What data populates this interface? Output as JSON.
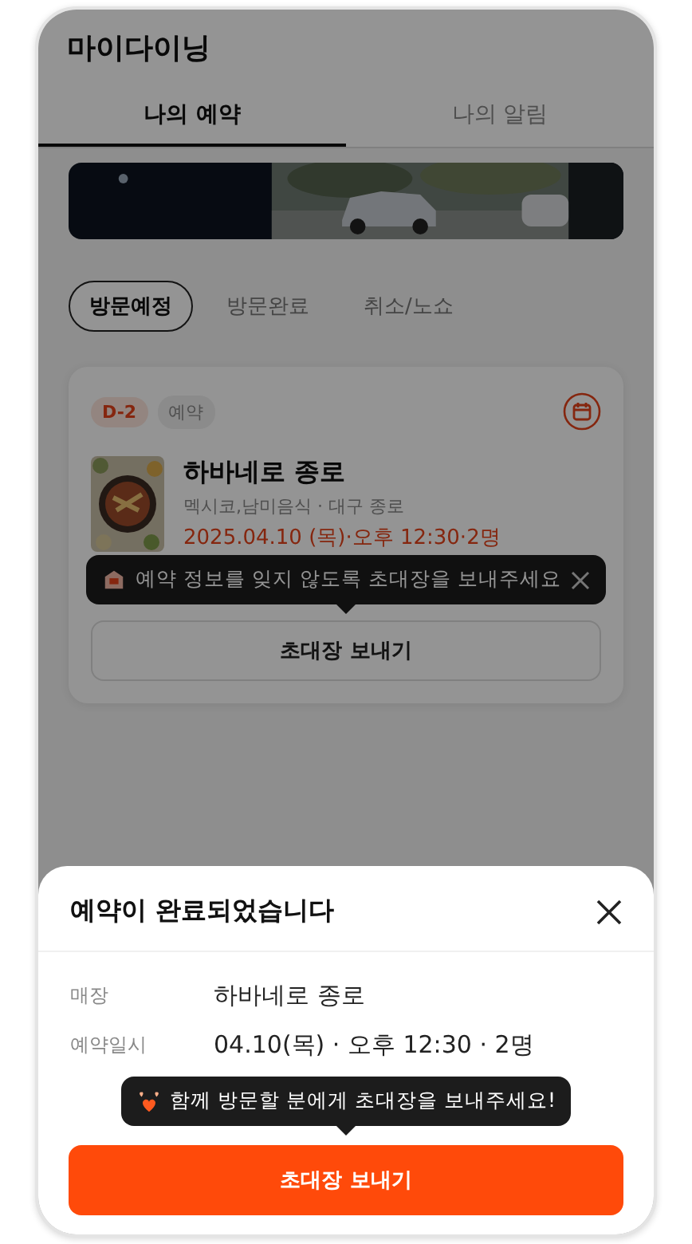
{
  "header": {
    "title": "마이다이닝"
  },
  "tabs": [
    {
      "label": "나의 예약",
      "selected": true
    },
    {
      "label": "나의 알림",
      "selected": false
    }
  ],
  "filters": [
    {
      "label": "방문예정",
      "selected": true
    },
    {
      "label": "방문완료",
      "selected": false
    },
    {
      "label": "취소/노쇼",
      "selected": false
    }
  ],
  "reservation_card": {
    "dday": "D-2",
    "status": "예약",
    "restaurant": "하바네로 종로",
    "category": "멕시코,남미음식 · 대구 종로",
    "datetime": "2025.04.10 (목)·오후 12:30·2명",
    "tooltip": "예약 정보를 잊지 않도록 초대장을 보내주세요",
    "button": "초대장 보내기"
  },
  "overlay": {
    "dimmed": true
  },
  "bottom_sheet": {
    "title": "예약이 완료되었습니다",
    "rows": [
      {
        "label": "매장",
        "value": "하바네로 종로"
      },
      {
        "label": "예약일시",
        "value": "04.10(목) · 오후 12:30 · 2명"
      }
    ],
    "tooltip": "함께 방문할 분에게 초대장을 보내주세요!",
    "button": "초대장 보내기"
  }
}
